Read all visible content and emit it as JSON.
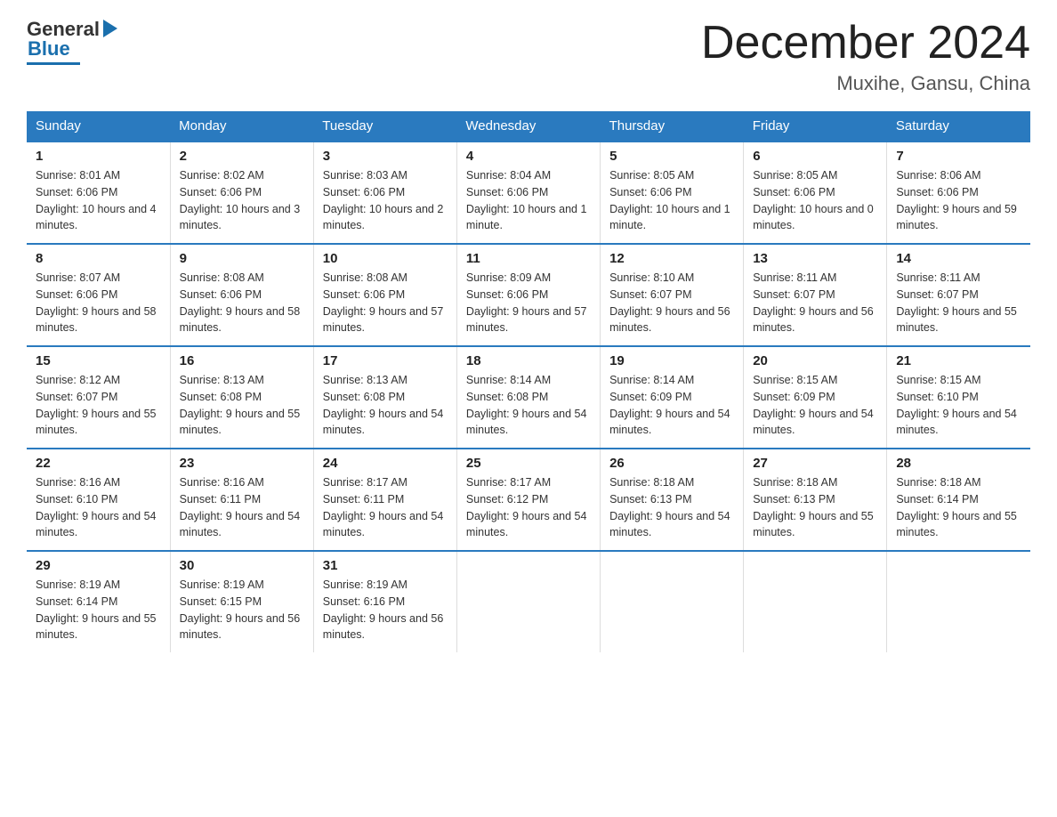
{
  "header": {
    "logo": {
      "general": "General",
      "blue": "Blue"
    },
    "title": "December 2024",
    "location": "Muxihe, Gansu, China"
  },
  "weekdays": [
    "Sunday",
    "Monday",
    "Tuesday",
    "Wednesday",
    "Thursday",
    "Friday",
    "Saturday"
  ],
  "weeks": [
    [
      {
        "day": "1",
        "sunrise": "8:01 AM",
        "sunset": "6:06 PM",
        "daylight": "10 hours and 4 minutes."
      },
      {
        "day": "2",
        "sunrise": "8:02 AM",
        "sunset": "6:06 PM",
        "daylight": "10 hours and 3 minutes."
      },
      {
        "day": "3",
        "sunrise": "8:03 AM",
        "sunset": "6:06 PM",
        "daylight": "10 hours and 2 minutes."
      },
      {
        "day": "4",
        "sunrise": "8:04 AM",
        "sunset": "6:06 PM",
        "daylight": "10 hours and 1 minute."
      },
      {
        "day": "5",
        "sunrise": "8:05 AM",
        "sunset": "6:06 PM",
        "daylight": "10 hours and 1 minute."
      },
      {
        "day": "6",
        "sunrise": "8:05 AM",
        "sunset": "6:06 PM",
        "daylight": "10 hours and 0 minutes."
      },
      {
        "day": "7",
        "sunrise": "8:06 AM",
        "sunset": "6:06 PM",
        "daylight": "9 hours and 59 minutes."
      }
    ],
    [
      {
        "day": "8",
        "sunrise": "8:07 AM",
        "sunset": "6:06 PM",
        "daylight": "9 hours and 58 minutes."
      },
      {
        "day": "9",
        "sunrise": "8:08 AM",
        "sunset": "6:06 PM",
        "daylight": "9 hours and 58 minutes."
      },
      {
        "day": "10",
        "sunrise": "8:08 AM",
        "sunset": "6:06 PM",
        "daylight": "9 hours and 57 minutes."
      },
      {
        "day": "11",
        "sunrise": "8:09 AM",
        "sunset": "6:06 PM",
        "daylight": "9 hours and 57 minutes."
      },
      {
        "day": "12",
        "sunrise": "8:10 AM",
        "sunset": "6:07 PM",
        "daylight": "9 hours and 56 minutes."
      },
      {
        "day": "13",
        "sunrise": "8:11 AM",
        "sunset": "6:07 PM",
        "daylight": "9 hours and 56 minutes."
      },
      {
        "day": "14",
        "sunrise": "8:11 AM",
        "sunset": "6:07 PM",
        "daylight": "9 hours and 55 minutes."
      }
    ],
    [
      {
        "day": "15",
        "sunrise": "8:12 AM",
        "sunset": "6:07 PM",
        "daylight": "9 hours and 55 minutes."
      },
      {
        "day": "16",
        "sunrise": "8:13 AM",
        "sunset": "6:08 PM",
        "daylight": "9 hours and 55 minutes."
      },
      {
        "day": "17",
        "sunrise": "8:13 AM",
        "sunset": "6:08 PM",
        "daylight": "9 hours and 54 minutes."
      },
      {
        "day": "18",
        "sunrise": "8:14 AM",
        "sunset": "6:08 PM",
        "daylight": "9 hours and 54 minutes."
      },
      {
        "day": "19",
        "sunrise": "8:14 AM",
        "sunset": "6:09 PM",
        "daylight": "9 hours and 54 minutes."
      },
      {
        "day": "20",
        "sunrise": "8:15 AM",
        "sunset": "6:09 PM",
        "daylight": "9 hours and 54 minutes."
      },
      {
        "day": "21",
        "sunrise": "8:15 AM",
        "sunset": "6:10 PM",
        "daylight": "9 hours and 54 minutes."
      }
    ],
    [
      {
        "day": "22",
        "sunrise": "8:16 AM",
        "sunset": "6:10 PM",
        "daylight": "9 hours and 54 minutes."
      },
      {
        "day": "23",
        "sunrise": "8:16 AM",
        "sunset": "6:11 PM",
        "daylight": "9 hours and 54 minutes."
      },
      {
        "day": "24",
        "sunrise": "8:17 AM",
        "sunset": "6:11 PM",
        "daylight": "9 hours and 54 minutes."
      },
      {
        "day": "25",
        "sunrise": "8:17 AM",
        "sunset": "6:12 PM",
        "daylight": "9 hours and 54 minutes."
      },
      {
        "day": "26",
        "sunrise": "8:18 AM",
        "sunset": "6:13 PM",
        "daylight": "9 hours and 54 minutes."
      },
      {
        "day": "27",
        "sunrise": "8:18 AM",
        "sunset": "6:13 PM",
        "daylight": "9 hours and 55 minutes."
      },
      {
        "day": "28",
        "sunrise": "8:18 AM",
        "sunset": "6:14 PM",
        "daylight": "9 hours and 55 minutes."
      }
    ],
    [
      {
        "day": "29",
        "sunrise": "8:19 AM",
        "sunset": "6:14 PM",
        "daylight": "9 hours and 55 minutes."
      },
      {
        "day": "30",
        "sunrise": "8:19 AM",
        "sunset": "6:15 PM",
        "daylight": "9 hours and 56 minutes."
      },
      {
        "day": "31",
        "sunrise": "8:19 AM",
        "sunset": "6:16 PM",
        "daylight": "9 hours and 56 minutes."
      },
      null,
      null,
      null,
      null
    ]
  ]
}
